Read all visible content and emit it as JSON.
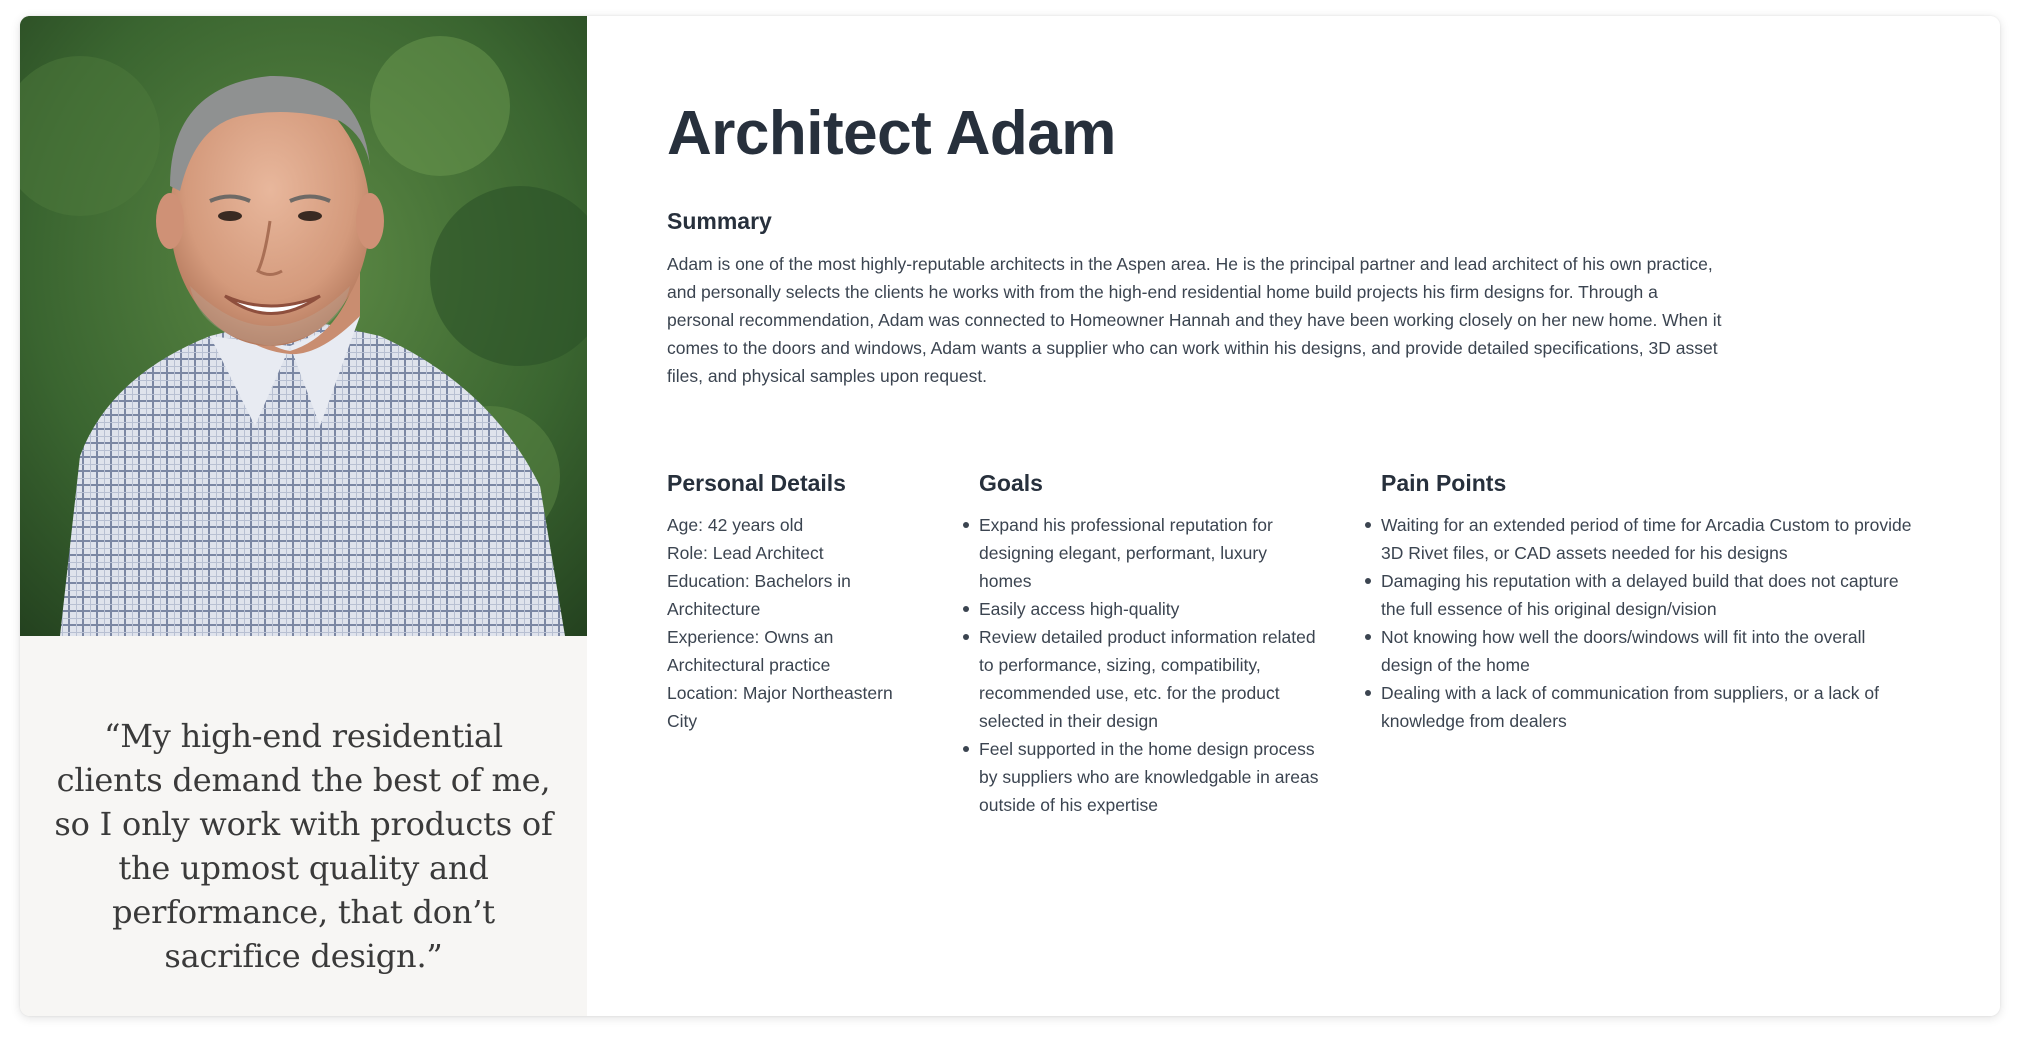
{
  "persona": {
    "name": "Architect Adam",
    "quote": "“My high-end residential clients demand the best of me, so I only work with products of the upmost quality and performance, that don’t sacrifice design.”"
  },
  "summary": {
    "heading": "Summary",
    "text": "Adam is one of the most highly-reputable architects in the Aspen area. He is the principal partner and lead architect of his own practice, and personally selects the clients he works with from the high-end residential home build projects his firm designs for. Through a personal recommendation, Adam was connected to Homeowner Hannah and they have been working closely on her new home. When it comes to the doors and windows, Adam wants a supplier who can work within his designs, and provide detailed specifications, 3D asset files, and physical samples upon request."
  },
  "personal_details": {
    "heading": "Personal Details",
    "items": [
      "Age: 42 years old",
      "Role: Lead Architect",
      "Education: Bachelors in Architecture",
      "Experience: Owns an Architectural practice",
      "Location: Major Northeastern City"
    ]
  },
  "goals": {
    "heading": "Goals",
    "items": [
      "Expand his professional reputation for designing elegant, performant, luxury homes",
      "Easily access high-quality",
      "Review detailed product information related to performance, sizing, compatibility, recommended use, etc. for the product selected in their design",
      "Feel supported in the home design process by suppliers who are knowledgable in areas outside of his expertise"
    ]
  },
  "pain_points": {
    "heading": "Pain Points",
    "items": [
      "Waiting for an extended period of time for Arcadia Custom to provide 3D Rivet files, or CAD assets needed for his designs",
      "Damaging his reputation with a delayed build that does not capture the full essence of his original design/vision",
      "Not knowing how well the doors/windows will fit into the overall design of the home",
      "Dealing with a lack of communication from suppliers, or a lack of knowledge from dealers"
    ]
  },
  "colors": {
    "heading_text": "#27303c",
    "body_text": "#3b4450",
    "quote_panel": "#f7f6f4",
    "photo_background": "#3f6a33"
  }
}
